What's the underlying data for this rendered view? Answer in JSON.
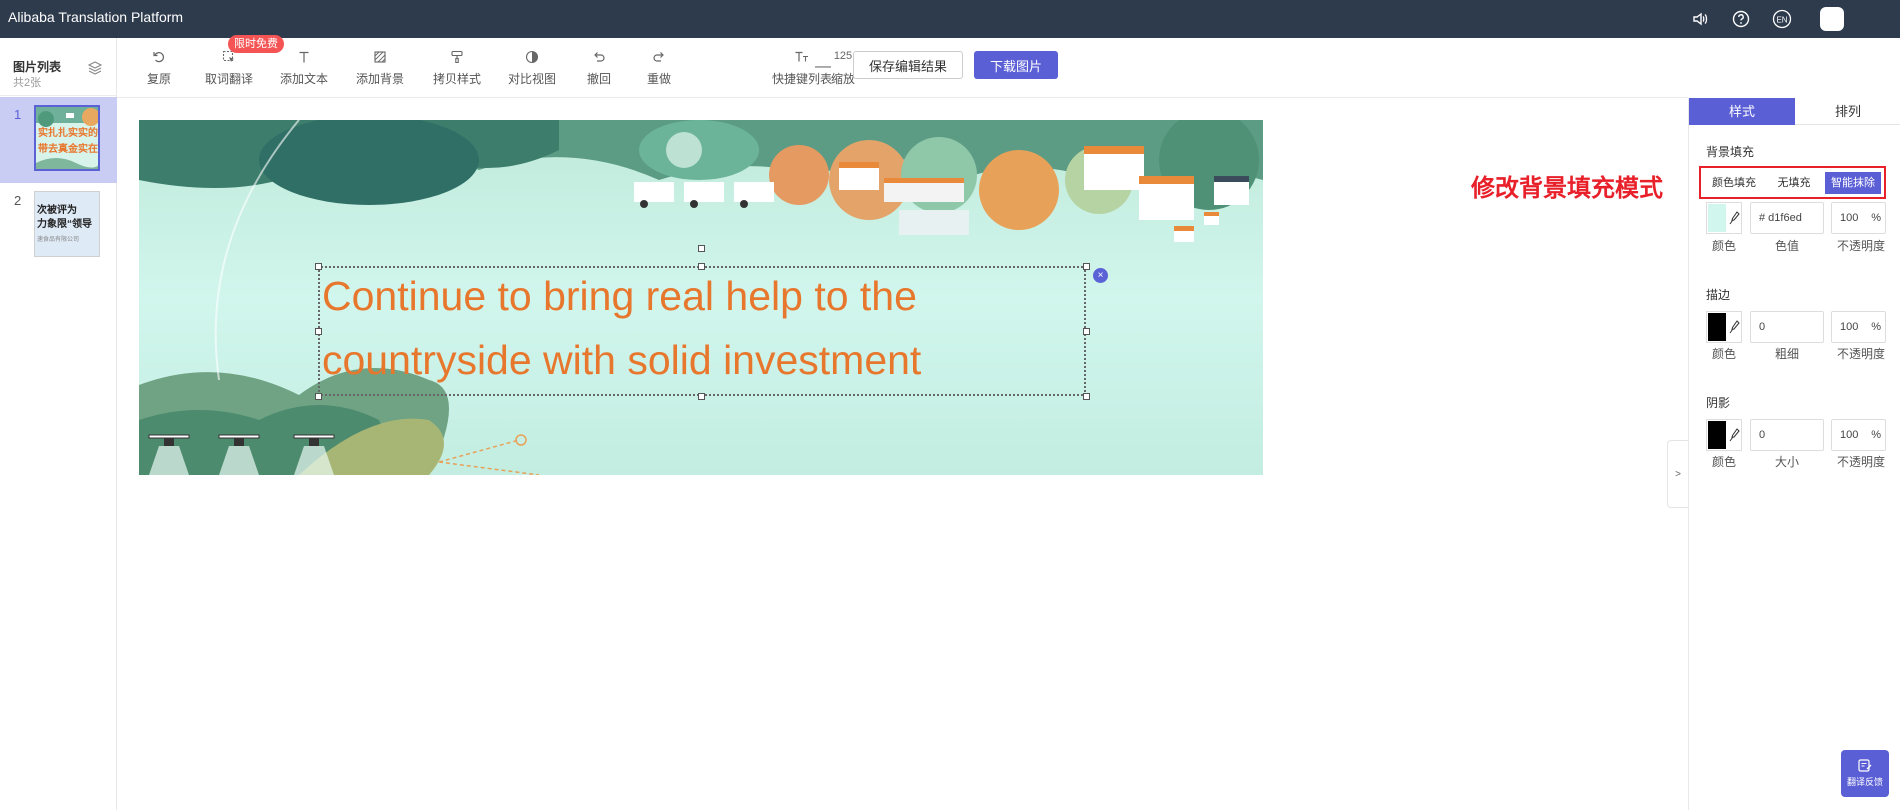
{
  "app": {
    "title": "Alibaba Translation Platform"
  },
  "topbar_icons": [
    {
      "name": "speaker-icon"
    },
    {
      "name": "help-icon"
    },
    {
      "name": "language-icon",
      "label": "EN"
    }
  ],
  "left_panel": {
    "title": "图片列表",
    "count": "共2张",
    "thumbnails": [
      {
        "number": "1",
        "lines": [
          "实扎扎实实的",
          "带去真金实在在"
        ],
        "active": true
      },
      {
        "number": "2",
        "lines": [
          "次被评为",
          "力象限“领导",
          "速食品有限公司"
        ],
        "active": false
      }
    ]
  },
  "toolbar": {
    "tools": [
      {
        "label": "复原",
        "icon": "reset-icon"
      },
      {
        "label": "取词翻译",
        "icon": "pick-translate-icon",
        "badge": "限时免费"
      },
      {
        "label": "添加文本",
        "icon": "add-text-icon"
      },
      {
        "label": "添加背景",
        "icon": "add-background-icon"
      },
      {
        "label": "拷贝样式",
        "icon": "copy-style-icon"
      },
      {
        "label": "对比视图",
        "icon": "compare-view-icon"
      },
      {
        "label": "撤回",
        "icon": "undo-icon"
      },
      {
        "label": "重做",
        "icon": "redo-icon"
      },
      {
        "label": "快捷键列表",
        "icon": "shortcut-list-icon"
      }
    ],
    "zoom": {
      "value": "125",
      "label": "缩放",
      "minus": "—",
      "plus": "+"
    },
    "save_label": "保存编辑结果",
    "download_label": "下载图片"
  },
  "canvas": {
    "overlay_lines": [
      "Continue to bring real help to the",
      "countryside with solid investment"
    ],
    "overlay_color": "#e8772e",
    "close_symbol": "×",
    "collapse_symbol": ">"
  },
  "annotation": {
    "text": "修改背景填充模式",
    "color": "#e8202a"
  },
  "right_panel": {
    "tabs": [
      "样式",
      "排列"
    ],
    "background_fill": {
      "title": "背景填充",
      "options": [
        "颜色填充",
        "无填充",
        "智能抹除"
      ],
      "selected": "智能抹除",
      "color_value": "# d1f6ed",
      "swatch_color": "#d1f6ed",
      "opacity": "100",
      "labels": {
        "color": "颜色",
        "value": "色值",
        "opacity": "不透明度"
      }
    },
    "stroke": {
      "title": "描边",
      "swatch_color": "#000000",
      "width": "0",
      "opacity": "100",
      "labels": {
        "color": "颜色",
        "width": "粗细",
        "opacity": "不透明度"
      }
    },
    "shadow": {
      "title": "阴影",
      "swatch_color": "#000000",
      "size": "0",
      "opacity": "100",
      "labels": {
        "color": "颜色",
        "size": "大小",
        "opacity": "不透明度"
      }
    },
    "percent_sign": "%"
  },
  "feedback": {
    "label": "翻译反馈"
  },
  "colors": {
    "accent": "#5b5fd6",
    "topbar": "#2e3b4d",
    "badge": "#f45454"
  }
}
